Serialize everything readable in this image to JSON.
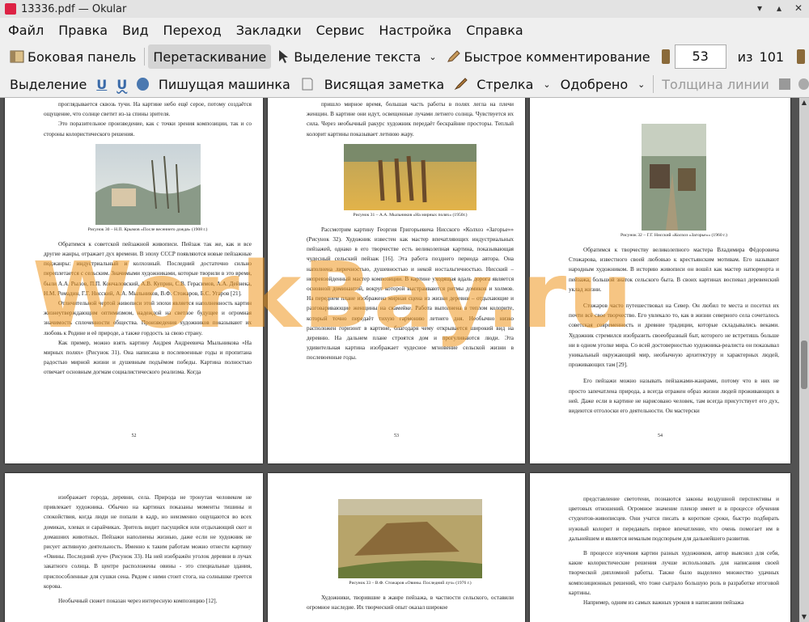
{
  "window": {
    "title": "13336.pdf — Okular"
  },
  "menu": [
    "Файл",
    "Правка",
    "Вид",
    "Переход",
    "Закладки",
    "Сервис",
    "Настройка",
    "Справка"
  ],
  "toolbar": {
    "sidebar": "Боковая панель",
    "drag": "Перетаскивание",
    "text_select": "Выделение текста",
    "quick_comment": "Быстрое комментирование",
    "page_current": "53",
    "page_of": "из",
    "page_total": "101"
  },
  "annot_toolbar": {
    "select": "Выделение",
    "typewriter": "Пишущая машинка",
    "sticky": "Висящая заметка",
    "arrow": "Стрелка",
    "stamp": "Одобрено",
    "line_width": "Толщина линии"
  },
  "watermark": "WorkBay.ru",
  "pages": [
    {
      "num": "52",
      "p1": "проглядывается сквозь тучи. На картине небо ещё серое, потому создаётся ощущение, что солнце светит из-за спины зрителя.",
      "p2": "Это поразительное произведение, как с точки зрения композиции, так и со стороны колористического решения.",
      "cap": "Рисунок 30 – Н.П. Крымов «После весеннего дождя» (1908 г.)",
      "p3": "Обратимся к советской пейзажной живописи. Пейзаж так же, как и все другие жанры, отражает дух времени. В эпоху СССР появляются новые пейзажные поджанры: индустриальный и колхозный. Последний достаточно сильно переплетается с сельским. Значимыми художниками, которые творили в это время, были А.А. Рылов, П.П. Кончаловский, А.В. Куприн, С.В. Герасимов, А.А. Дейнека, Н.М. Ромадин, Г.Г. Нисский, А.А. Мыльников, В.Ф. Стожаров, Б.С. Угаров [21].",
      "p4": "Отличительной чертой живописи этой эпохи является наполненность картин жизнеутверждающим оптимизмом, надеждой на светлое будущее и огромная значимость сплоченности общества. Произведения художников показывают их любовь к Родине и её природе, а также гордость за свою страну.",
      "p5": "Как пример, можно взять картину Андрея Андреевича Мыльникова «На мирных полях» (Рисунок 31). Она написана в послевоенные годы и пропитана радостью мирной жизни и душевным подъёмом победы. Картина полностью отвечает основным догмам социалистического реализма. Когда"
    },
    {
      "num": "53",
      "p1": "пришло мирное время, большая часть работы в полях легла на плечи женщин. В картине они идут, освещенные лучами летнего солнца. Чувствуется их сила. Через необычный ракурс художник передаёт бескрайние просторы. Теплый колорит картины показывает летнюю жару.",
      "cap": "Рисунок 31 – А.А. Мыльников «На мирных полях» (1950г.)",
      "p2": "Рассмотрим картину Георгия Григорьевича Нисского «Колхоз «Загорье»» (Рисунок 32). Художник известен как мастер впечатляющих индустриальных пейзажей, однако в его творчестве есть великолепная картина, показывающая чудесный сельский пейзаж [16]. Эта работа позднего периода автора. Она наполнена лиричностью, душевностью и некой ностальгичностью. Нисский – непревзойденный мастер композиции. В картине уходящая вдаль дорога является основной доминантой, вокруг которой выстраиваются ритмы домиков и холмов. На переднем плане изображена мирная сцена из жизни деревни – отдыхающие и разговаривающие женщины на скамейке. Работа выполнена в теплом колорите, который точно передаёт тихую гармонию летнего дня. Необычно низко расположен горизонт в картине, благодаря чему открывается широкий вид на деревню. На дальнем плане строятся дом и прогуливаются люди. Эта удивительная картина изображает чудесное мгновение сельской жизни в послевоенные годы."
    },
    {
      "num": "54",
      "cap": "Рисунок 32 – Г.Г. Нисский «Колхоз «Загорье»» (1960 г.)",
      "p1": "Обратимся к творчеству великолепного мастера Владимира Фёдоровича Стожарова, известного своей любовью к крестьянским мотивам. Его называют народным художником. В историю живописи он вошёл как мастер натюрморта и пейзажа, большой знаток сельского быта. В своих картинах воспевал деревенский уклад жизни.",
      "p2": "Стожаров часто путешествовал на Север. Он любил те места и посетил их почти всё свое творчество. Его увлекало то, как в жизни северного села сочеталось советская современность и древние традиции, которые складывались веками. Художник стремился изобразить своеобразный быт, которого не встретишь больше ни в одном уголке мира. Со всей достоверностью художника-реалиста он показывал уникальный окружающий мир, необычную архитектуру и характерных людей, проживающих там [29].",
      "p3": "Его пейзажи можно называть пейзажами-жанрами, потому что в них не просто запечатлена природа, а всегда отражен образ жизни людей проживающих в ней. Даже если в картине не нарисовано человек, там всегда присутствует его дух, видеются отголоски его деятельности. Он мастерски"
    },
    {
      "p1": "изображает города, деревни, села. Природа не тронутая человеком не привлекает художника. Обычно на картинах показаны моменты тишины и спокойствия, когда люди не попали в кадр, но неизменно ощущаются во всех домиках, хлевах и сарайчиках. Зритель видит пасущийся или отдыхающий скот и домашних животных. Пейзажи наполнены жизнью, даже если не художник не рисует активную деятельность. Именно к таким работам можно отнести картину «Овины. Последний луч» (Рисунок 33). На ней изображён уголок деревни в лучах закатного солнца. В центре расположены овины - это специальные здания, приспособленные для сушки сена. Рядом с ними стоит стога, на солнышке греется корова.",
      "p2": "Необычный сюжет показан через интересную композицию [12]."
    },
    {
      "cap": "Рисунок 33 – В.Ф. Стожаров «Овины. Последний луч» (1976 г.)",
      "p1": "Художники, творившие в жанре пейзажа, в частности сельского, оставили огромное наследие. Их творческий опыт оказал широкое"
    },
    {
      "p1": "представление светотени, познаются законы воздушной перспективы и цветовых отношений. Огромное значение пленэр имеет и в процессе обучения студентов-живописцев. Они учатся писать в короткие сроки, быстро подбирать нужный колорит и передавать первое впечатление, что очень помогает им в дальнейшем и является немалым подспорьем для дальнейшего развития.",
      "p2": "В процессе изучения картин разных художников, автор выяснил для себя, какие колористические решения лучше использовать для написания своей творческой дипломной работы. Также было выделено множество удачных композиционных решений, что тоже сыграло большую роль в разработке итоговой картины.",
      "p3": "Например, одним из самых важных уроков в написании пейзажа"
    }
  ]
}
